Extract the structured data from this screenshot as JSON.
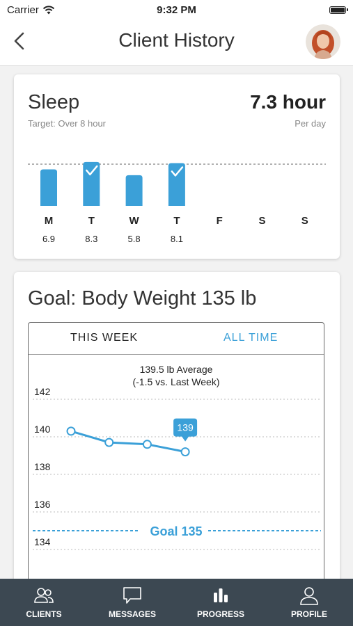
{
  "status": {
    "carrier": "Carrier",
    "time": "9:32 PM"
  },
  "nav": {
    "title": "Client History",
    "back_icon": "chevron-left-icon"
  },
  "sleep": {
    "title": "Sleep",
    "target": "Target: Over 8 hour",
    "value": "7.3 hour",
    "period": "Per day",
    "target_hours": 8,
    "days": [
      {
        "label": "M",
        "value": "6.9",
        "hours": 6.9,
        "met": false
      },
      {
        "label": "T",
        "value": "8.3",
        "hours": 8.3,
        "met": true
      },
      {
        "label": "W",
        "value": "5.8",
        "hours": 5.8,
        "met": false
      },
      {
        "label": "T",
        "value": "8.1",
        "hours": 8.1,
        "met": true
      },
      {
        "label": "F",
        "value": "",
        "hours": null,
        "met": false
      },
      {
        "label": "S",
        "value": "",
        "hours": null,
        "met": false
      },
      {
        "label": "S",
        "value": "",
        "hours": null,
        "met": false
      }
    ],
    "bar_color": "#3ba0d8"
  },
  "weight": {
    "title": "Goal: Body Weight 135 lb",
    "tabs": [
      "THIS WEEK",
      "ALL TIME"
    ],
    "active_tab": "THIS WEEK",
    "average_line1": "139.5 lb Average",
    "average_line2": "(-1.5 vs. Last Week)",
    "callout": "139",
    "goal_label": "Goal 135"
  },
  "chart_data": {
    "type": "line",
    "y_ticks": [
      "142",
      "140",
      "138",
      "136",
      "134"
    ],
    "ylim": [
      133,
      143
    ],
    "goal": 135,
    "series": [
      {
        "values": [
          140.3,
          139.7,
          139.6,
          139.2
        ]
      }
    ],
    "accent": "#3ba0d8"
  },
  "tabbar": {
    "items": [
      {
        "label": "CLIENTS",
        "icon": "clients-icon"
      },
      {
        "label": "MESSAGES",
        "icon": "messages-icon"
      },
      {
        "label": "PROGRESS",
        "icon": "progress-icon"
      },
      {
        "label": "PROFILE",
        "icon": "profile-icon"
      }
    ],
    "active": "PROGRESS"
  }
}
